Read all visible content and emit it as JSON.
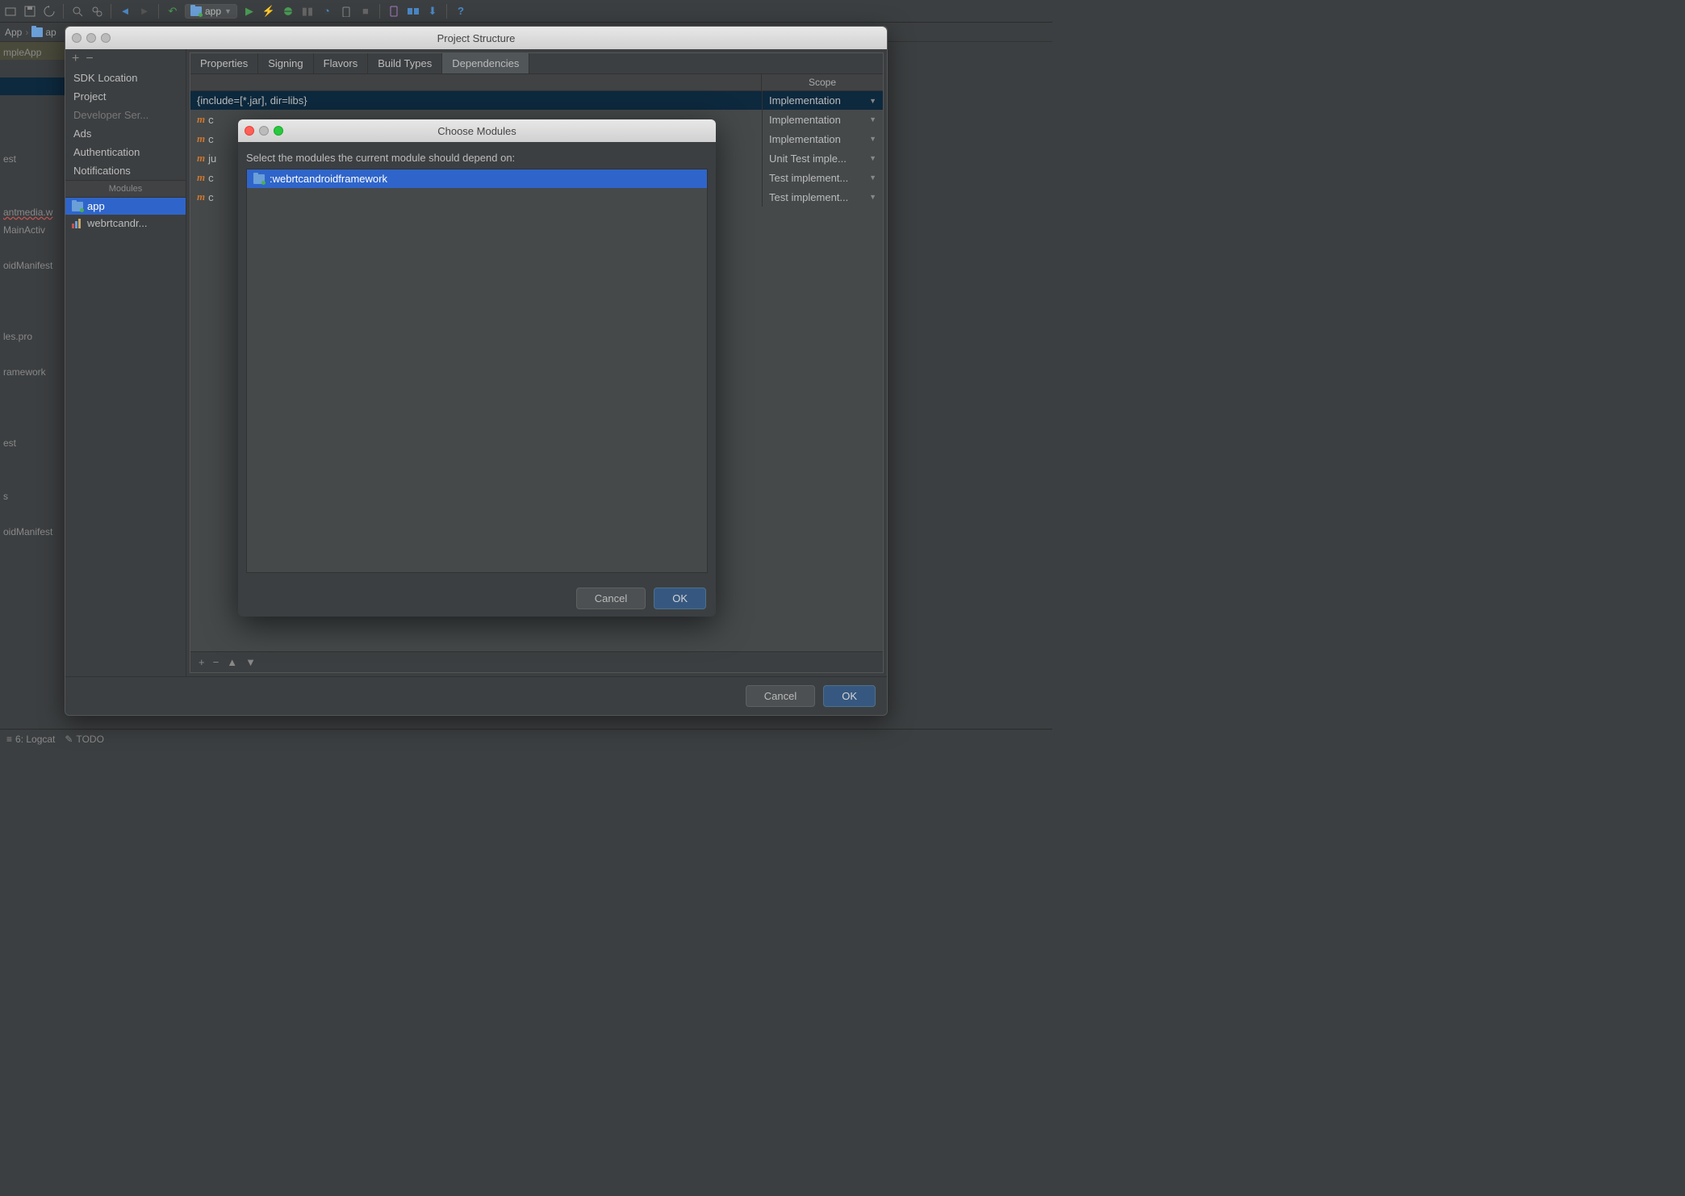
{
  "toolbar": {
    "run_config": "app"
  },
  "breadcrumb": {
    "root": "App",
    "item": "ap"
  },
  "left_gutter": [
    {
      "text": "mpleApp",
      "hl": true
    },
    {
      "text": ""
    },
    {
      "text": "",
      "sel": true
    },
    {
      "text": ""
    },
    {
      "text": ""
    },
    {
      "text": ""
    },
    {
      "text": "est"
    },
    {
      "text": ""
    },
    {
      "text": ""
    },
    {
      "text": "antmedia.w",
      "err": true
    },
    {
      "text": " MainActiv"
    },
    {
      "text": ""
    },
    {
      "text": "oidManifest"
    },
    {
      "text": ""
    },
    {
      "text": ""
    },
    {
      "text": ""
    },
    {
      "text": "les.pro"
    },
    {
      "text": ""
    },
    {
      "text": "ramework"
    },
    {
      "text": ""
    },
    {
      "text": ""
    },
    {
      "text": ""
    },
    {
      "text": "est"
    },
    {
      "text": ""
    },
    {
      "text": ""
    },
    {
      "text": "s"
    },
    {
      "text": ""
    },
    {
      "text": "oidManifest"
    }
  ],
  "status": {
    "logcat": "6: Logcat",
    "todo": "TODO"
  },
  "ps": {
    "title": "Project Structure",
    "sidebar": {
      "items": [
        "SDK Location",
        "Project",
        "Developer Ser...",
        "Ads",
        "Authentication",
        "Notifications"
      ],
      "modules_hdr": "Modules",
      "modules": [
        "app",
        "webrtcandr..."
      ]
    },
    "tabs": [
      "Properties",
      "Signing",
      "Flavors",
      "Build Types",
      "Dependencies"
    ],
    "scope_hdr": "Scope",
    "deps": [
      {
        "name": "{include=[*.jar], dir=libs}",
        "scope": "Implementation",
        "sel": true,
        "m": false
      },
      {
        "name": "c",
        "scope": "Implementation",
        "m": true
      },
      {
        "name": "c",
        "scope": "Implementation",
        "m": true
      },
      {
        "name": "ju",
        "scope": "Unit Test imple...",
        "m": true
      },
      {
        "name": "c",
        "scope": "Test implement...",
        "m": true
      },
      {
        "name": "c",
        "scope": "Test implement...",
        "m": true
      }
    ],
    "cancel": "Cancel",
    "ok": "OK"
  },
  "cm": {
    "title": "Choose Modules",
    "label": "Select the modules the current module should depend on:",
    "item": ":webrtcandroidframework",
    "cancel": "Cancel",
    "ok": "OK"
  }
}
